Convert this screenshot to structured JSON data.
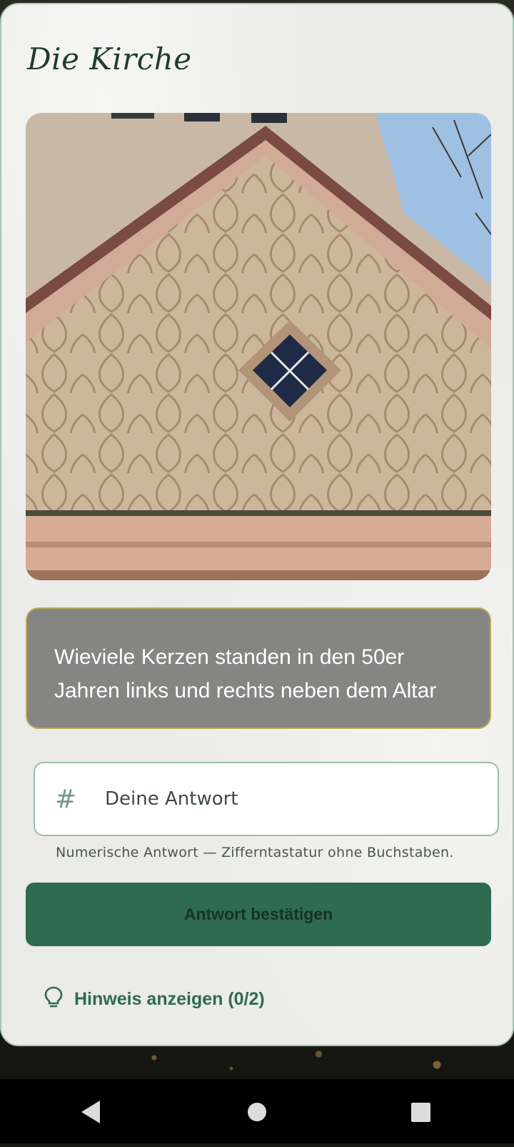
{
  "screen": {
    "title": "Die Kirche",
    "photo_alt": "Kirchengiebel",
    "question": "Wieviele Kerzen standen in den 50er Jahren links und rechts neben dem Altar",
    "answer": {
      "placeholder": "Deine Antwort",
      "value": "",
      "icon": "hash-icon",
      "helper": "Numerische Antwort — Zifferntastatur ohne Buchstaben."
    },
    "confirm_label": "Antwort bestätigen",
    "hint_label": "Hinweis anzeigen (0/2)"
  },
  "navbar": {
    "back": "back-icon",
    "home": "home-icon",
    "recents": "recents-icon"
  },
  "colors": {
    "accent": "#2e6b4f",
    "question_bg": "#858584",
    "card_bg": "#ebebe9"
  }
}
